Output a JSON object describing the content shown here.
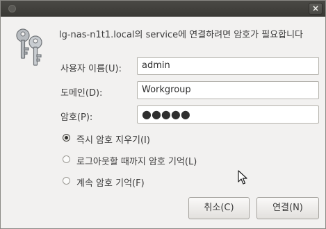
{
  "window": {
    "close_label": "×"
  },
  "dialog": {
    "message": "lg-nas-n1t1.local의 service에 연결하려면 암호가 필요합니다",
    "fields": [
      {
        "label": "사용자 이름(U):",
        "value": "admin"
      },
      {
        "label": "도메인(D):",
        "value": "Workgroup"
      },
      {
        "label": "암호(P):",
        "value": "●●●●●"
      }
    ],
    "options": [
      {
        "label": "즉시 암호 지우기(I)",
        "checked": true
      },
      {
        "label": "로그아웃할 때까지 암호 기억(L)",
        "checked": false
      },
      {
        "label": "계속 암호 기억(F)",
        "checked": false
      }
    ],
    "buttons": {
      "cancel": "취소(C)",
      "connect": "연결(N)"
    }
  },
  "icons": {
    "dialog_icon": "keys-icon",
    "window_menu": "window-menu-icon",
    "close": "close-icon",
    "cursor": "mouse-pointer-icon"
  }
}
